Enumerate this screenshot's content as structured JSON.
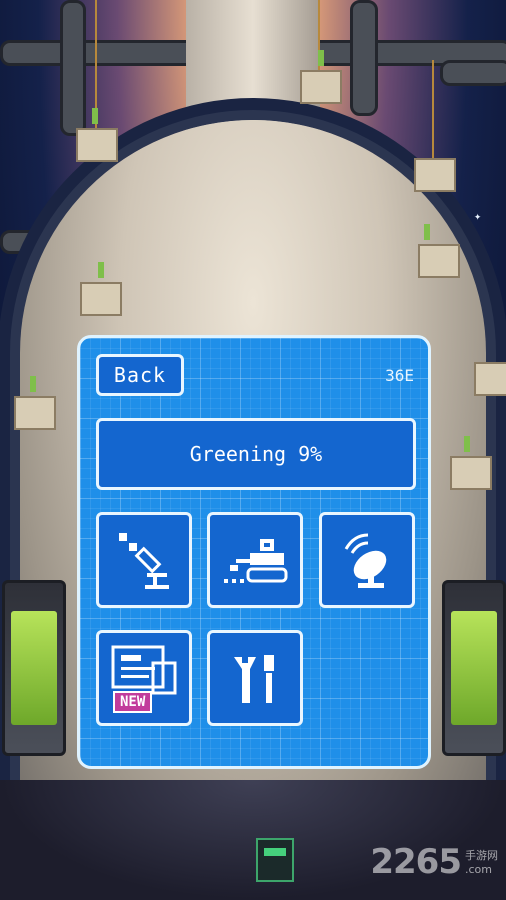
{
  "panel": {
    "back_label": "Back",
    "currency": "36E",
    "greening_label": "Greening 9%"
  },
  "tiles": [
    {
      "icon": "laser-cannon-icon"
    },
    {
      "icon": "rover-robot-icon"
    },
    {
      "icon": "satellite-dish-icon"
    },
    {
      "icon": "blueprint-icon",
      "badge": "NEW"
    },
    {
      "icon": "tools-icon"
    }
  ],
  "watermark": {
    "brand": "2265",
    "sub_cn": "手游网",
    "sub_domain": ".com"
  },
  "colors": {
    "panel_blue": "#1f8fe9",
    "button_blue": "#1466cf",
    "badge_magenta": "#c23c9c",
    "tank_green": "#9ed34a"
  }
}
